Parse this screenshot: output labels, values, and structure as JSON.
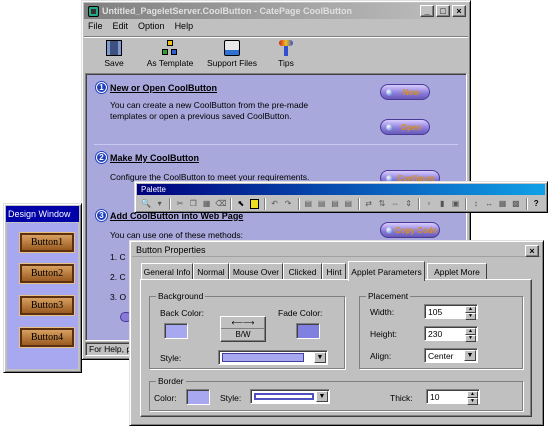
{
  "main_window": {
    "title": "Untitled_PageletServer.CoolButton - CatePage CoolButton",
    "menu": [
      "File",
      "Edit",
      "Option",
      "Help"
    ],
    "toolbar": [
      {
        "label": "Save",
        "icon": "save-icon"
      },
      {
        "label": "As Template",
        "icon": "template-icon"
      },
      {
        "label": "Support Files",
        "icon": "support-files-icon"
      },
      {
        "label": "Tips",
        "icon": "tips-icon"
      }
    ],
    "step1": {
      "num": "1",
      "title": "New or Open CoolButton",
      "text1": "You can create a new CoolButton from the pre-made",
      "text2": "templates or open a previous saved CoolButton.",
      "btn_new": "New",
      "btn_open": "Open"
    },
    "step2": {
      "num": "2",
      "title": "Make My CoolButton",
      "text1": "Configure the CoolButton to meet your requirements.",
      "btn_configure": "Configure"
    },
    "step3": {
      "num": "3",
      "title": "Add CoolButton into Web Page",
      "text1": "You can use one of these methods:",
      "item1": "1. C",
      "item2": "2. C",
      "item3": "3. O",
      "btn_copy": "Copy Code"
    },
    "status": "For Help, p"
  },
  "design_window": {
    "title": "Design Window",
    "buttons": [
      "Button1",
      "Button2",
      "Button3",
      "Button4"
    ]
  },
  "palette": {
    "title": "Palette"
  },
  "props": {
    "title": "Button Properties",
    "close": "×",
    "tabs": [
      "General Info",
      "Normal",
      "Mouse Over",
      "Clicked",
      "Hint",
      "Applet Parameters",
      "Applet More"
    ],
    "active_tab": "Applet Parameters",
    "background": {
      "label": "Background",
      "back_color": "Back Color:",
      "fade_color": "Fade Color:",
      "bw_arrows": "⟵⟶",
      "bw": "B/W",
      "style": "Style:"
    },
    "placement": {
      "label": "Placement",
      "width_label": "Width:",
      "width": "105",
      "height_label": "Height:",
      "height": "230",
      "align_label": "Align:",
      "align": "Center"
    },
    "border": {
      "label": "Border",
      "color": "Color:",
      "style": "Style:",
      "thick_label": "Thick:",
      "thick": "10"
    }
  },
  "colors": {
    "title_active": "#00007c",
    "swatch": "#a8a8f0",
    "panel_purple": "#a8a8e0"
  }
}
